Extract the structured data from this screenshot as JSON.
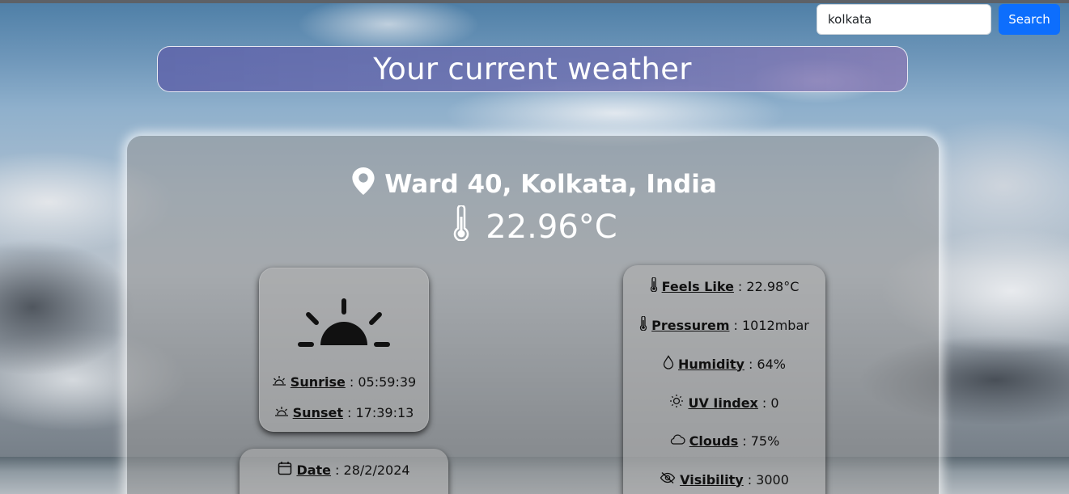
{
  "search": {
    "value": "kolkata",
    "button_label": "Search"
  },
  "header": {
    "title": "Your current weather"
  },
  "current": {
    "location": "Ward 40, Kolkata, India",
    "temperature": "22.96°C"
  },
  "sun": {
    "sunrise_label": "Sunrise",
    "sunrise_value": ": 05:59:39",
    "sunset_label": "Sunset",
    "sunset_value": ": 17:39:13"
  },
  "date": {
    "date_label": "Date",
    "date_value": ": 28/2/2024"
  },
  "stats": [
    {
      "label": "Feels Like",
      "value": ": 22.98°C",
      "icon": "thermometer-icon"
    },
    {
      "label": "Pressurem",
      "value": ": 1012mbar",
      "icon": "thermometer-icon"
    },
    {
      "label": "Humidity",
      "value": ": 64%",
      "icon": "droplet-icon"
    },
    {
      "label": "UV Iindex",
      "value": ": 0",
      "icon": "sun-icon"
    },
    {
      "label": "Clouds",
      "value": ": 75%",
      "icon": "cloud-icon"
    },
    {
      "label": "Visibility",
      "value": ": 3000",
      "icon": "eye-slash-icon"
    }
  ]
}
